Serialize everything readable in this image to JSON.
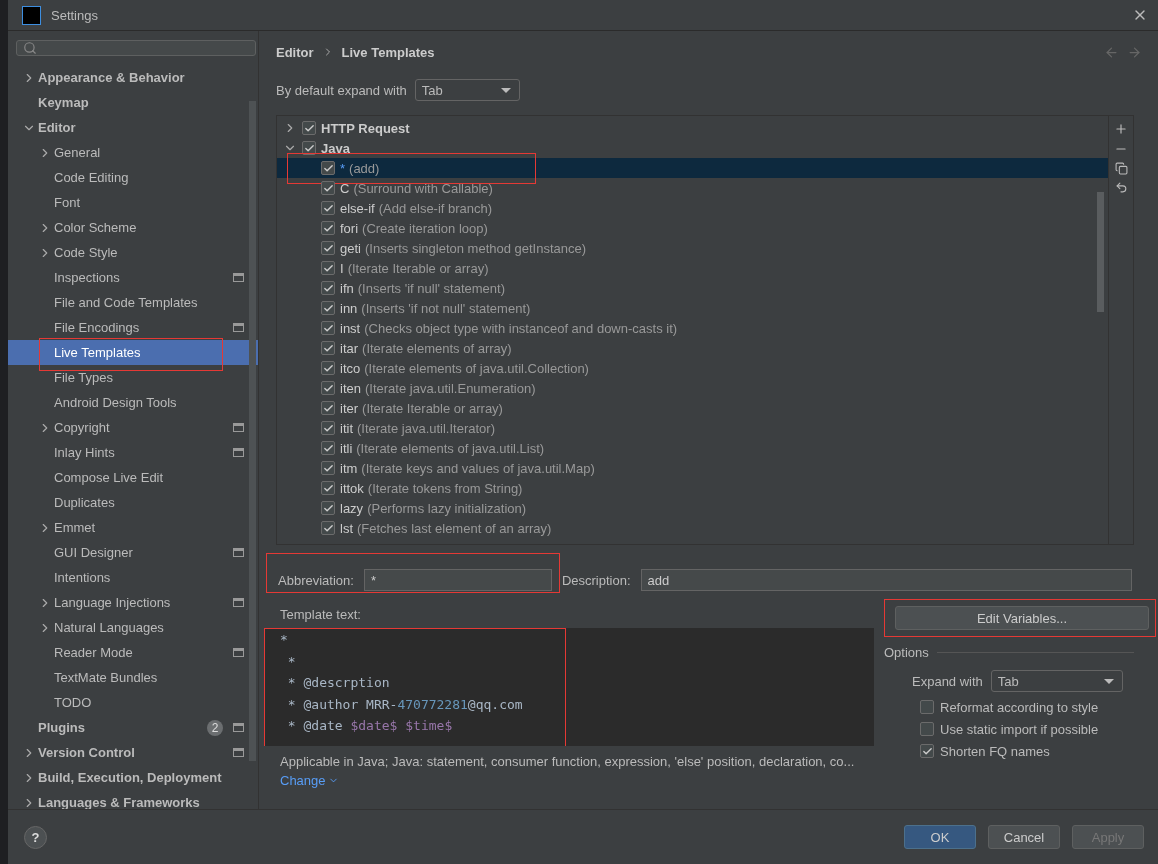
{
  "window": {
    "title": "Settings"
  },
  "sidebar": {
    "items": [
      {
        "label": "Appearance & Behavior",
        "expanded": false
      },
      {
        "label": "Keymap"
      },
      {
        "label": "Editor",
        "expanded": true,
        "children": [
          {
            "label": "General",
            "expanded": false
          },
          {
            "label": "Code Editing"
          },
          {
            "label": "Font"
          },
          {
            "label": "Color Scheme",
            "expanded": false
          },
          {
            "label": "Code Style",
            "expanded": false
          },
          {
            "label": "Inspections",
            "scoped": true
          },
          {
            "label": "File and Code Templates"
          },
          {
            "label": "File Encodings",
            "scoped": true
          },
          {
            "label": "Live Templates",
            "selected": true,
            "annotated": true
          },
          {
            "label": "File Types"
          },
          {
            "label": "Android Design Tools"
          },
          {
            "label": "Copyright",
            "expanded": false,
            "scoped": true
          },
          {
            "label": "Inlay Hints",
            "scoped": true
          },
          {
            "label": "Compose Live Edit"
          },
          {
            "label": "Duplicates"
          },
          {
            "label": "Emmet",
            "expanded": false
          },
          {
            "label": "GUI Designer",
            "scoped": true
          },
          {
            "label": "Intentions"
          },
          {
            "label": "Language Injections",
            "expanded": false,
            "scoped": true
          },
          {
            "label": "Natural Languages",
            "expanded": false
          },
          {
            "label": "Reader Mode",
            "scoped": true
          },
          {
            "label": "TextMate Bundles"
          },
          {
            "label": "TODO"
          }
        ]
      },
      {
        "label": "Plugins",
        "count": "2",
        "scoped": true
      },
      {
        "label": "Version Control",
        "expanded": false,
        "scoped": true
      },
      {
        "label": "Build, Execution, Deployment",
        "expanded": false
      },
      {
        "label": "Languages & Frameworks",
        "expanded": false
      }
    ]
  },
  "breadcrumb": [
    "Editor",
    "Live Templates"
  ],
  "expand_default": {
    "label": "By default expand with",
    "value": "Tab"
  },
  "templates": [
    {
      "name": "HTTP Request",
      "checked": true,
      "expanded": false
    },
    {
      "name": "Java",
      "checked": true,
      "expanded": true,
      "children": [
        {
          "abbr": "*",
          "desc": "(add)",
          "checked": true,
          "selected": true,
          "annotated": true
        },
        {
          "abbr": "C",
          "desc": "(Surround with Callable)",
          "checked": true,
          "selected": false
        },
        {
          "abbr": "else-if",
          "desc": "(Add else-if branch)",
          "checked": true,
          "selected": false
        },
        {
          "abbr": "fori",
          "desc": "(Create iteration loop)",
          "checked": true,
          "selected": false
        },
        {
          "abbr": "geti",
          "desc": "(Inserts singleton method getInstance)",
          "checked": true,
          "selected": false
        },
        {
          "abbr": "I",
          "desc": "(Iterate Iterable or array)",
          "checked": true,
          "selected": false
        },
        {
          "abbr": "ifn",
          "desc": "(Inserts 'if null' statement)",
          "checked": true,
          "selected": false
        },
        {
          "abbr": "inn",
          "desc": "(Inserts 'if not null' statement)",
          "checked": true,
          "selected": false
        },
        {
          "abbr": "inst",
          "desc": "(Checks object type with instanceof and down-casts it)",
          "checked": true,
          "selected": false
        },
        {
          "abbr": "itar",
          "desc": "(Iterate elements of array)",
          "checked": true,
          "selected": false
        },
        {
          "abbr": "itco",
          "desc": "(Iterate elements of java.util.Collection)",
          "checked": true,
          "selected": false
        },
        {
          "abbr": "iten",
          "desc": "(Iterate java.util.Enumeration)",
          "checked": true,
          "selected": false
        },
        {
          "abbr": "iter",
          "desc": "(Iterate Iterable or array)",
          "checked": true,
          "selected": false
        },
        {
          "abbr": "itit",
          "desc": "(Iterate java.util.Iterator)",
          "checked": true,
          "selected": false
        },
        {
          "abbr": "itli",
          "desc": "(Iterate elements of java.util.List)",
          "checked": true,
          "selected": false
        },
        {
          "abbr": "itm",
          "desc": "(Iterate keys and values of java.util.Map)",
          "checked": true,
          "selected": false
        },
        {
          "abbr": "ittok",
          "desc": "(Iterate tokens from String)",
          "checked": true,
          "selected": false
        },
        {
          "abbr": "lazy",
          "desc": "(Performs lazy initialization)",
          "checked": true,
          "selected": false
        },
        {
          "abbr": "lst",
          "desc": "(Fetches last element of an array)",
          "checked": true,
          "selected": false
        }
      ]
    }
  ],
  "abbreviation": {
    "label": "Abbreviation:",
    "value": "*",
    "annotated": true
  },
  "description": {
    "label": "Description:",
    "value": "add"
  },
  "template_text": {
    "label": "Template text:",
    "annotated": true,
    "lines": [
      [
        {
          "kind": "plain",
          "text": "*"
        }
      ],
      [
        {
          "kind": "plain",
          "text": " *"
        }
      ],
      [
        {
          "kind": "plain",
          "text": " * @descrption"
        }
      ],
      [
        {
          "kind": "plain",
          "text": " * @author MRR-"
        },
        {
          "kind": "number",
          "text": "470772281"
        },
        {
          "kind": "plain",
          "text": "@qq.com"
        }
      ],
      [
        {
          "kind": "plain",
          "text": " * @date "
        },
        {
          "kind": "variable",
          "text": "$date$ "
        },
        {
          "kind": "variable",
          "text": "$time$"
        }
      ]
    ]
  },
  "applicable": "Applicable in Java; Java: statement, consumer function, expression, 'else' position, declaration, co...",
  "change_link": "Change",
  "edit_variables": {
    "label": "Edit Variables...",
    "annotated": true
  },
  "options": {
    "title": "Options",
    "expand_label": "Expand with",
    "expand_value": "Tab",
    "checkboxes": [
      {
        "label": "Reformat according to style",
        "checked": false
      },
      {
        "label": "Use static import if possible",
        "checked": false
      },
      {
        "label": "Shorten FQ names",
        "checked": true
      }
    ]
  },
  "help": "?",
  "buttons": [
    {
      "label": "OK",
      "kind": "primary"
    },
    {
      "label": "Cancel",
      "kind": "normal"
    },
    {
      "label": "Apply",
      "kind": "disabled"
    }
  ]
}
